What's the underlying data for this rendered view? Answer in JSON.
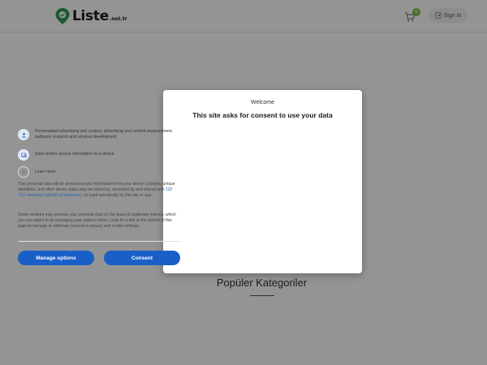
{
  "header": {
    "logo_text": "Liste",
    "logo_sub": ".net.tr",
    "cart_count": "0",
    "signin_label": "Sign In"
  },
  "main": {
    "section_title": "Popüler Kategoriler"
  },
  "consent": {
    "welcome": "Welcome",
    "title": "This site asks for consent to use your data",
    "purposes": [
      {
        "icon": "user-icon",
        "text": "Personalised advertising and content, advertising and content measurement, audience research and services development"
      },
      {
        "icon": "device-icon",
        "text": "Store and/or access information on a device"
      }
    ],
    "learn_more": "Learn more",
    "para1_a": "Your personal data will be processed and information from your device (cookies, unique identifiers, and other device data) may be stored by, accessed by and shared with ",
    "para1_link": "132 TCF vendor(s) and 66 ad partner(s)",
    "para1_b": ", or used specifically by this site or app.",
    "para2": "Some vendors may process your personal data on the basis of legitimate interest, which you can object to by managing your options below. Look for a link at the bottom of this page to manage or withdraw consent in privacy and cookie settings.",
    "manage_label": "Manage options",
    "consent_label": "Consent"
  },
  "colors": {
    "accent": "#1a5fc8",
    "brand_green": "#2e9e4f",
    "badge_green": "#7cc242"
  }
}
